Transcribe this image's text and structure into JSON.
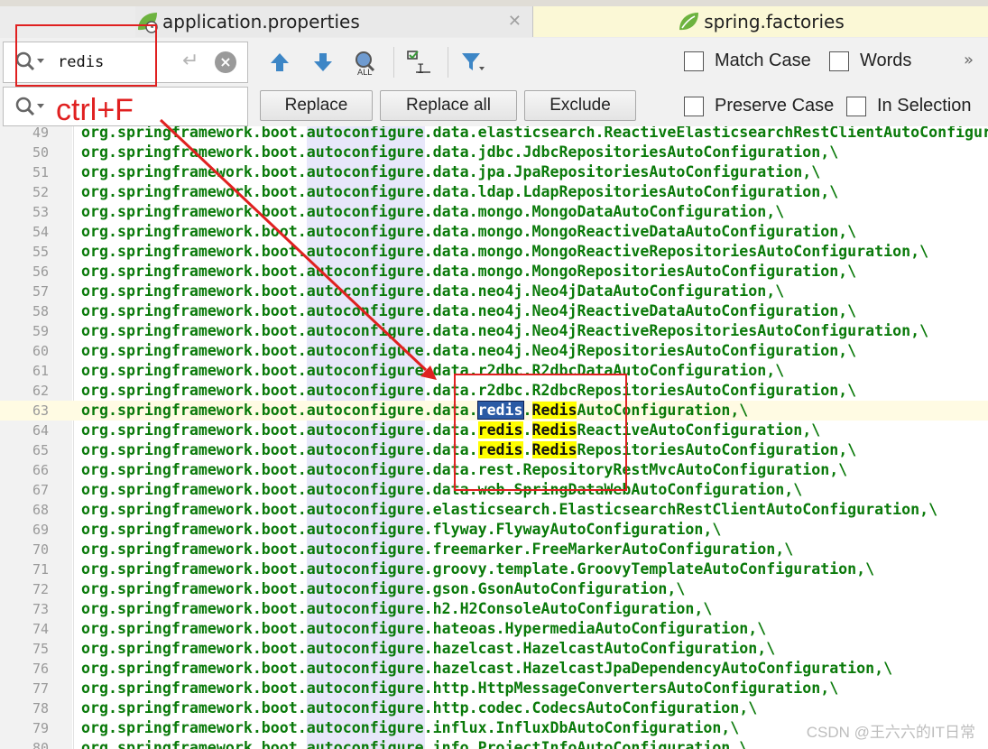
{
  "tabs": [
    {
      "label": "application.properties"
    },
    {
      "label": "spring.factories"
    }
  ],
  "find": {
    "query": "redis",
    "replace_value": "",
    "buttons": {
      "replace": "Replace",
      "replace_all": "Replace all",
      "exclude": "Exclude"
    },
    "options": {
      "match_case": "Match Case",
      "words": "Words",
      "preserve_case": "Preserve Case",
      "in_selection": "In Selection"
    },
    "more": "»"
  },
  "editor": {
    "lines": [
      {
        "num": "49",
        "text": "org.springframework.boot.autoconfigure.data.elasticsearch.ReactiveElasticsearchRestClientAutoConfigur"
      },
      {
        "num": "50",
        "text": "org.springframework.boot.autoconfigure.data.jdbc.JdbcRepositoriesAutoConfiguration,\\"
      },
      {
        "num": "51",
        "text": "org.springframework.boot.autoconfigure.data.jpa.JpaRepositoriesAutoConfiguration,\\"
      },
      {
        "num": "52",
        "text": "org.springframework.boot.autoconfigure.data.ldap.LdapRepositoriesAutoConfiguration,\\"
      },
      {
        "num": "53",
        "text": "org.springframework.boot.autoconfigure.data.mongo.MongoDataAutoConfiguration,\\"
      },
      {
        "num": "54",
        "text": "org.springframework.boot.autoconfigure.data.mongo.MongoReactiveDataAutoConfiguration,\\"
      },
      {
        "num": "55",
        "text": "org.springframework.boot.autoconfigure.data.mongo.MongoReactiveRepositoriesAutoConfiguration,\\"
      },
      {
        "num": "56",
        "text": "org.springframework.boot.autoconfigure.data.mongo.MongoRepositoriesAutoConfiguration,\\"
      },
      {
        "num": "57",
        "text": "org.springframework.boot.autoconfigure.data.neo4j.Neo4jDataAutoConfiguration,\\"
      },
      {
        "num": "58",
        "text": "org.springframework.boot.autoconfigure.data.neo4j.Neo4jReactiveDataAutoConfiguration,\\"
      },
      {
        "num": "59",
        "text": "org.springframework.boot.autoconfigure.data.neo4j.Neo4jReactiveRepositoriesAutoConfiguration,\\"
      },
      {
        "num": "60",
        "text": "org.springframework.boot.autoconfigure.data.neo4j.Neo4jRepositoriesAutoConfiguration,\\"
      },
      {
        "num": "61",
        "text": "org.springframework.boot.autoconfigure.data.r2dbc.R2dbcDataAutoConfiguration,\\"
      },
      {
        "num": "62",
        "text": "org.springframework.boot.autoconfigure.data.r2dbc.R2dbcRepositoriesAutoConfiguration,\\"
      },
      {
        "num": "63",
        "prefix": "org.springframework.boot.autoconfigure.data.",
        "m1": "redis",
        "dot": ".",
        "m2": "Redis",
        "suffix": "AutoConfiguration,\\",
        "current": true
      },
      {
        "num": "64",
        "prefix": "org.springframework.boot.autoconfigure.data.",
        "m1": "redis",
        "dot": ".",
        "m2": "Redis",
        "suffix": "ReactiveAutoConfiguration,\\"
      },
      {
        "num": "65",
        "prefix": "org.springframework.boot.autoconfigure.data.",
        "m1": "redis",
        "dot": ".",
        "m2": "Redis",
        "suffix": "RepositoriesAutoConfiguration,\\"
      },
      {
        "num": "66",
        "text": "org.springframework.boot.autoconfigure.data.rest.RepositoryRestMvcAutoConfiguration,\\"
      },
      {
        "num": "67",
        "text": "org.springframework.boot.autoconfigure.data.web.SpringDataWebAutoConfiguration,\\"
      },
      {
        "num": "68",
        "text": "org.springframework.boot.autoconfigure.elasticsearch.ElasticsearchRestClientAutoConfiguration,\\"
      },
      {
        "num": "69",
        "text": "org.springframework.boot.autoconfigure.flyway.FlywayAutoConfiguration,\\"
      },
      {
        "num": "70",
        "text": "org.springframework.boot.autoconfigure.freemarker.FreeMarkerAutoConfiguration,\\"
      },
      {
        "num": "71",
        "text": "org.springframework.boot.autoconfigure.groovy.template.GroovyTemplateAutoConfiguration,\\"
      },
      {
        "num": "72",
        "text": "org.springframework.boot.autoconfigure.gson.GsonAutoConfiguration,\\"
      },
      {
        "num": "73",
        "text": "org.springframework.boot.autoconfigure.h2.H2ConsoleAutoConfiguration,\\"
      },
      {
        "num": "74",
        "text": "org.springframework.boot.autoconfigure.hateoas.HypermediaAutoConfiguration,\\"
      },
      {
        "num": "75",
        "text": "org.springframework.boot.autoconfigure.hazelcast.HazelcastAutoConfiguration,\\"
      },
      {
        "num": "76",
        "text": "org.springframework.boot.autoconfigure.hazelcast.HazelcastJpaDependencyAutoConfiguration,\\"
      },
      {
        "num": "77",
        "text": "org.springframework.boot.autoconfigure.http.HttpMessageConvertersAutoConfiguration,\\"
      },
      {
        "num": "78",
        "text": "org.springframework.boot.autoconfigure.http.codec.CodecsAutoConfiguration,\\"
      },
      {
        "num": "79",
        "text": "org.springframework.boot.autoconfigure.influx.InfluxDbAutoConfiguration,\\"
      },
      {
        "num": "80",
        "text": "org.springframework.boot.autoconfigure.info.ProjectInfoAutoConfiguration,\\"
      }
    ]
  },
  "annotation": {
    "label": "ctrl+F",
    "color": "#e02020"
  },
  "watermark": "CSDN @王六六的IT日常",
  "colors": {
    "code": "#0a7a0a",
    "match_highlight": "#ffff00",
    "selection": "#2a5aa5",
    "accent_red": "#e02020"
  }
}
